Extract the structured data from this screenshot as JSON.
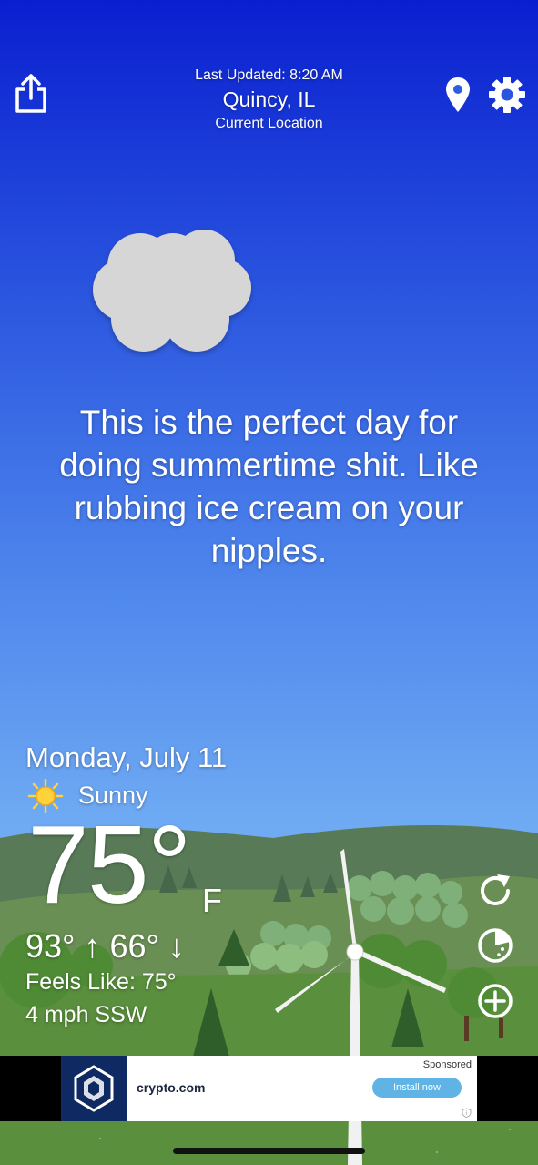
{
  "header": {
    "last_updated": "Last Updated: 8:20 AM",
    "city": "Quincy, IL",
    "location_label": "Current Location"
  },
  "icons": {
    "share": "share-icon",
    "location": "map-pin-icon",
    "settings": "gear-icon",
    "cloud": "cloud-icon",
    "sun": "sun-icon",
    "refresh": "refresh-icon",
    "radar": "radar-icon",
    "add_location": "plus-circle-icon"
  },
  "quote": "This is the perfect day for doing summertime shit. Like rubbing ice cream on your nipples.",
  "weather": {
    "date": "Monday, July 11",
    "condition": "Sunny",
    "temperature": "75°",
    "unit": "F",
    "high_low": "93° ↑  66° ↓",
    "feels_like": "Feels Like: 75°",
    "wind": "4 mph SSW"
  },
  "ad": {
    "sponsored": "Sponsored",
    "brand": "crypto.com",
    "cta": "Install now"
  },
  "colors": {
    "sky_top": "#0a1fd0",
    "sky_bottom": "#86c0f5",
    "hills_far": "#5b7f5a",
    "hills_near": "#5f9a3f",
    "ad_cta": "#5fb4e5"
  }
}
